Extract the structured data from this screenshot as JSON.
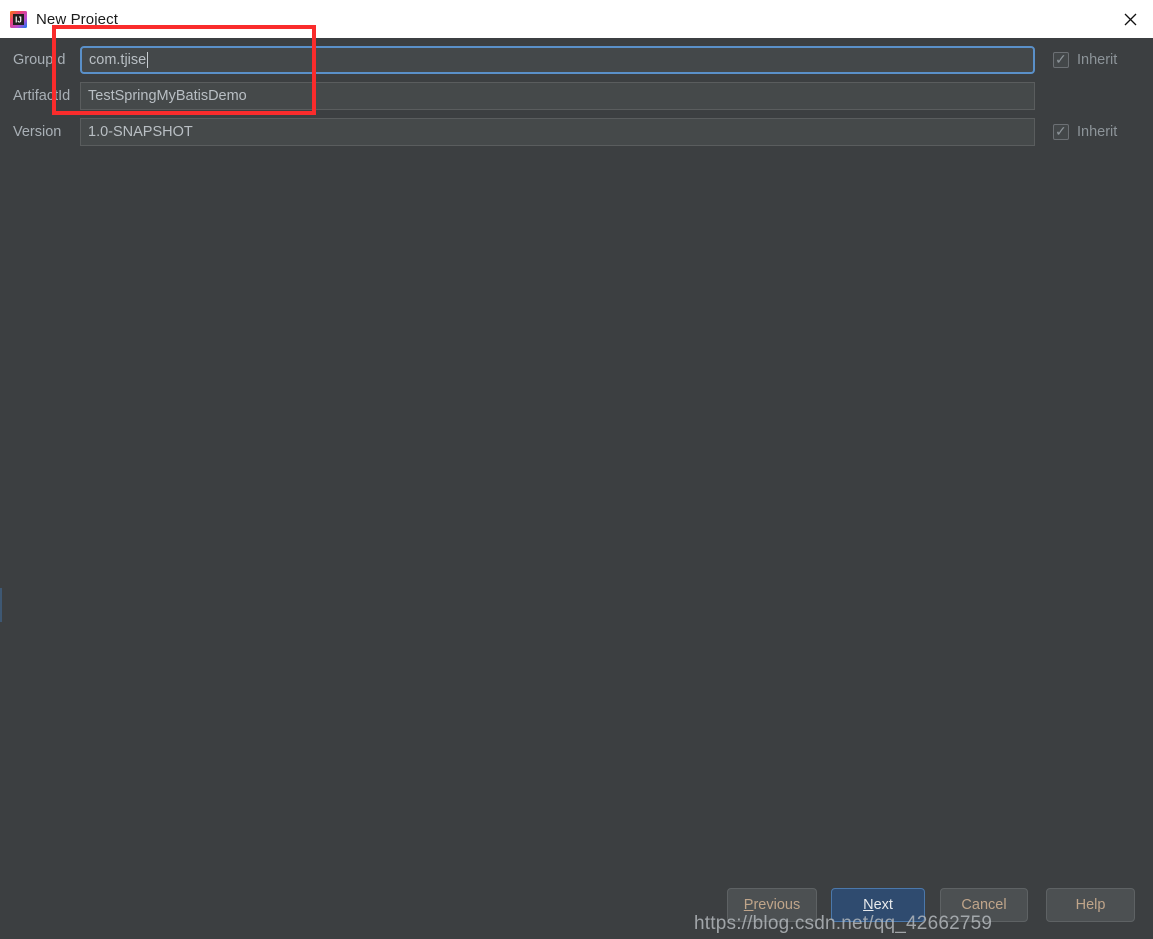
{
  "window": {
    "title": "New Project",
    "icon": "intellij-idea-icon",
    "close_icon": "close-icon"
  },
  "form": {
    "rows": [
      {
        "label": "GroupId",
        "value": "com.tjise",
        "focused": true,
        "has_inherit": true,
        "inherit_label": "Inherit",
        "inherit_checked": true
      },
      {
        "label": "ArtifactId",
        "value": "TestSpringMyBatisDemo",
        "focused": false,
        "has_inherit": false,
        "inherit_label": "",
        "inherit_checked": false
      },
      {
        "label": "Version",
        "value": "1.0-SNAPSHOT",
        "focused": false,
        "has_inherit": true,
        "inherit_label": "Inherit",
        "inherit_checked": true
      }
    ]
  },
  "buttons": {
    "previous": {
      "label": "Previous",
      "mnemonic": "P",
      "rest": "revious"
    },
    "next": {
      "label": "Next",
      "mnemonic": "N",
      "rest": "ext"
    },
    "cancel": {
      "label": "Cancel",
      "mnemonic": "C",
      "rest": "ancel"
    },
    "help": {
      "label": "Help",
      "mnemonic": "H",
      "rest": "elp"
    }
  },
  "annotation": {
    "color": "#fa2c2c"
  },
  "watermark": {
    "text": "https://blog.csdn.net/qq_42662759"
  },
  "colors": {
    "background": "#3c3f41",
    "titlebar": "#ffffff",
    "field_border": "#5a5d5e",
    "focus_border": "#5a90c9",
    "next_button": "#2f4b6f",
    "button_text": "#c0a58a",
    "label_text": "#a9b0b6"
  }
}
